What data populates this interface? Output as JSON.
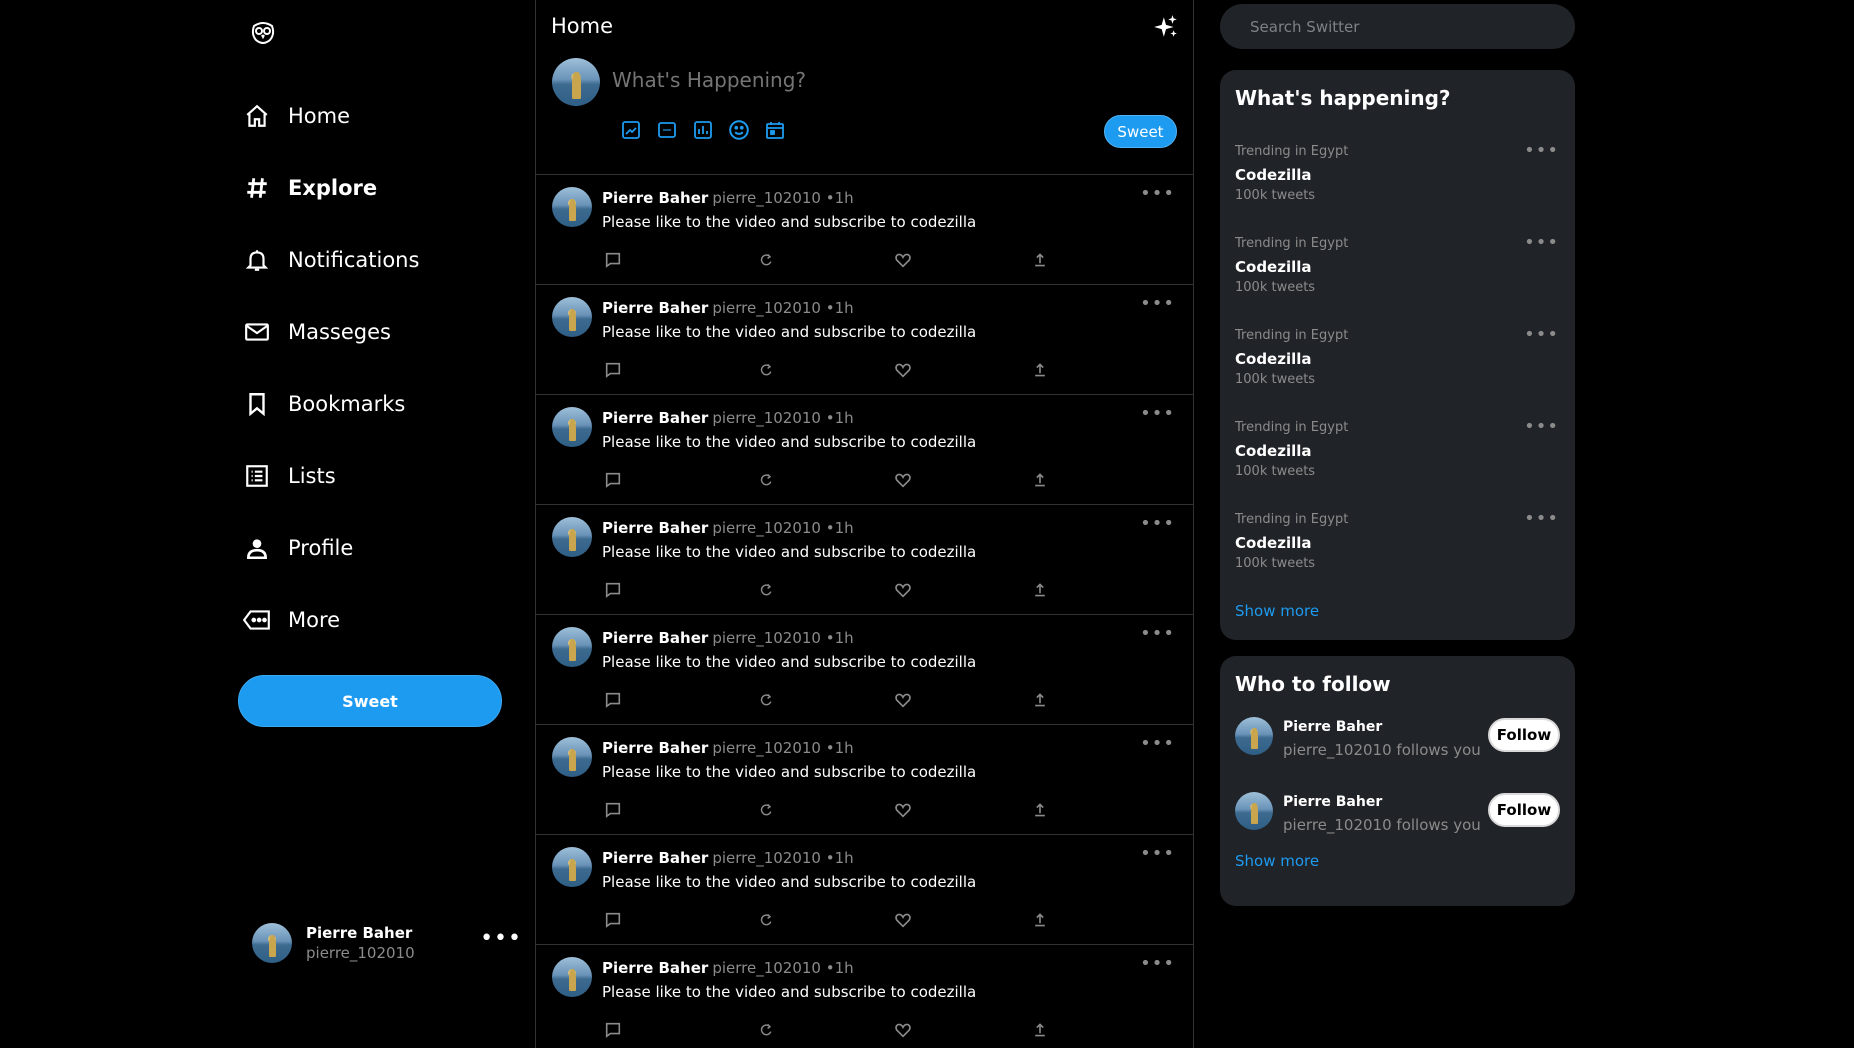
{
  "app": {
    "logo_icon": "owl-logo-icon"
  },
  "nav": {
    "items": [
      {
        "label": "Home",
        "icon": "home-icon",
        "bold": false
      },
      {
        "label": "Explore",
        "icon": "hashtag-icon",
        "bold": true
      },
      {
        "label": "Notifications",
        "icon": "bell-icon",
        "bold": false
      },
      {
        "label": "Masseges",
        "icon": "mail-icon",
        "bold": false
      },
      {
        "label": "Bookmarks",
        "icon": "bookmark-icon",
        "bold": false
      },
      {
        "label": "Lists",
        "icon": "list-icon",
        "bold": false
      },
      {
        "label": "Profile",
        "icon": "person-icon",
        "bold": false
      },
      {
        "label": "More",
        "icon": "more-tag-icon",
        "bold": false
      }
    ],
    "sweet_label": "Sweet"
  },
  "current_user": {
    "name": "Pierre Baher",
    "handle": "pierre_102010",
    "menu": "•••"
  },
  "feed": {
    "title": "Home",
    "compose": {
      "placeholder": "What's Happening?",
      "tools": [
        "image-icon",
        "gif-icon",
        "poll-icon",
        "emoji-icon",
        "schedule-icon"
      ],
      "submit_label": "Sweet"
    },
    "tweets": [
      {
        "name": "Pierre Baher",
        "handle": "pierre_102010",
        "time": "•1h",
        "text": "Please like to the video and subscribe to codezilla",
        "more": "•••"
      },
      {
        "name": "Pierre Baher",
        "handle": "pierre_102010",
        "time": "•1h",
        "text": "Please like to the video and subscribe to codezilla",
        "more": "•••"
      },
      {
        "name": "Pierre Baher",
        "handle": "pierre_102010",
        "time": "•1h",
        "text": "Please like to the video and subscribe to codezilla",
        "more": "•••"
      },
      {
        "name": "Pierre Baher",
        "handle": "pierre_102010",
        "time": "•1h",
        "text": "Please like to the video and subscribe to codezilla",
        "more": "•••"
      },
      {
        "name": "Pierre Baher",
        "handle": "pierre_102010",
        "time": "•1h",
        "text": "Please like to the video and subscribe to codezilla",
        "more": "•••"
      },
      {
        "name": "Pierre Baher",
        "handle": "pierre_102010",
        "time": "•1h",
        "text": "Please like to the video and subscribe to codezilla",
        "more": "•••"
      },
      {
        "name": "Pierre Baher",
        "handle": "pierre_102010",
        "time": "•1h",
        "text": "Please like to the video and subscribe to codezilla",
        "more": "•••"
      },
      {
        "name": "Pierre Baher",
        "handle": "pierre_102010",
        "time": "•1h",
        "text": "Please like to the video and subscribe to codezilla",
        "more": "•••"
      }
    ]
  },
  "search": {
    "placeholder": "Search Switter"
  },
  "trends": {
    "title": "What's happening?",
    "items": [
      {
        "context": "Trending in Egypt",
        "topic": "Codezilla",
        "count": "100k tweets"
      },
      {
        "context": "Trending in Egypt",
        "topic": "Codezilla",
        "count": "100k tweets"
      },
      {
        "context": "Trending in Egypt",
        "topic": "Codezilla",
        "count": "100k tweets"
      },
      {
        "context": "Trending in Egypt",
        "topic": "Codezilla",
        "count": "100k tweets"
      },
      {
        "context": "Trending in Egypt",
        "topic": "Codezilla",
        "count": "100k tweets"
      }
    ],
    "show_more": "Show more",
    "menu": "•••"
  },
  "who_to_follow": {
    "title": "Who to follow",
    "users": [
      {
        "name": "Pierre Baher",
        "subtitle": "pierre_102010 follows you",
        "button": "Follow"
      },
      {
        "name": "Pierre Baher",
        "subtitle": "pierre_102010 follows you",
        "button": "Follow"
      }
    ],
    "show_more": "Show more"
  },
  "colors": {
    "accent": "#1d9bf0",
    "background": "#000000",
    "card": "#202327",
    "border": "#2f3336",
    "muted": "#8b8b8b"
  }
}
